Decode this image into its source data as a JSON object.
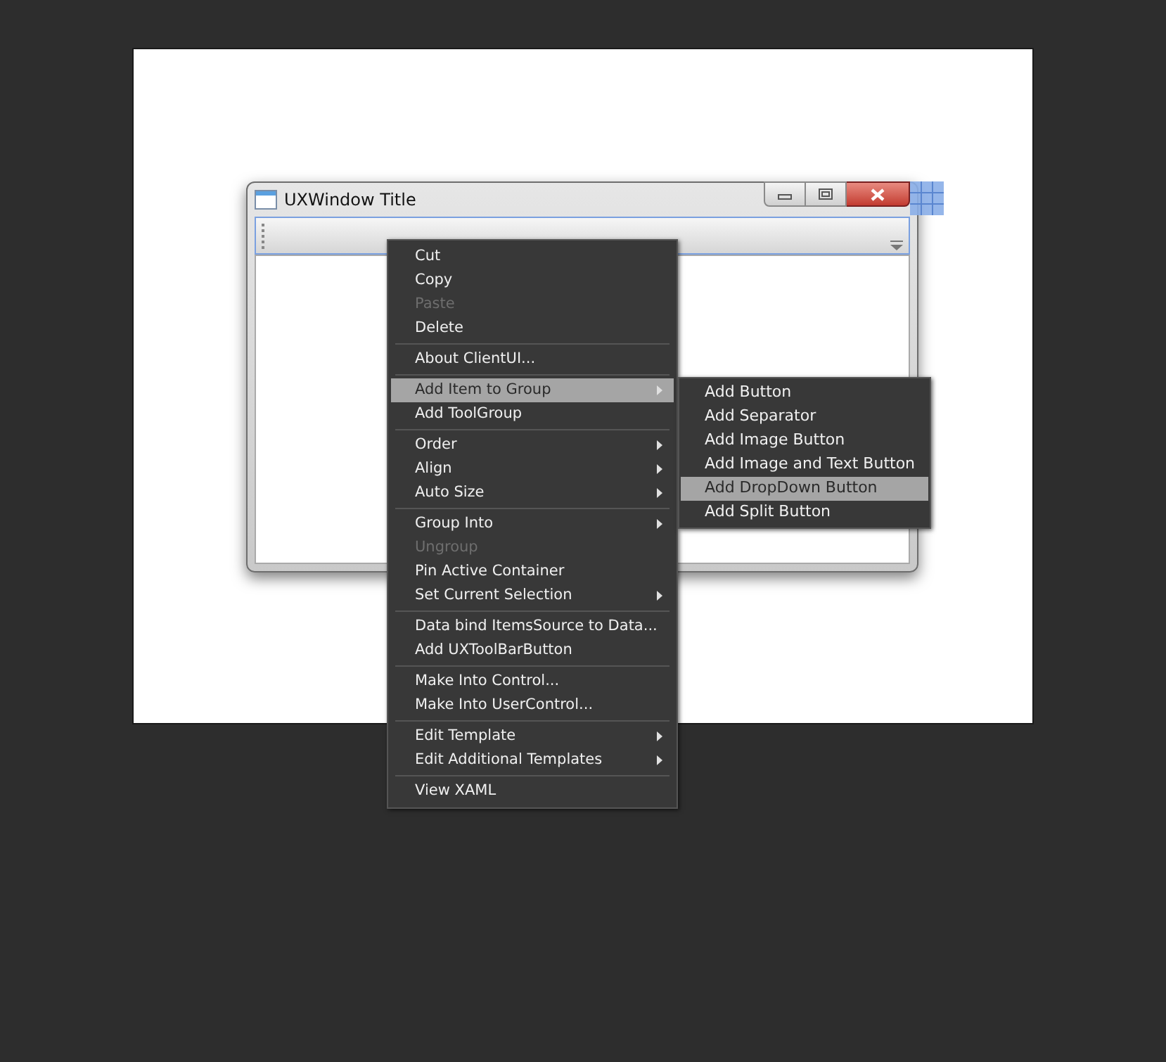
{
  "window": {
    "title": "UXWindow Title"
  },
  "context_menu": {
    "items": [
      {
        "kind": "item",
        "label": "Cut",
        "disabled": false,
        "selected": false,
        "submenu": false
      },
      {
        "kind": "item",
        "label": "Copy",
        "disabled": false,
        "selected": false,
        "submenu": false
      },
      {
        "kind": "item",
        "label": "Paste",
        "disabled": true,
        "selected": false,
        "submenu": false
      },
      {
        "kind": "item",
        "label": "Delete",
        "disabled": false,
        "selected": false,
        "submenu": false
      },
      {
        "kind": "separator"
      },
      {
        "kind": "item",
        "label": "About ClientUI...",
        "disabled": false,
        "selected": false,
        "submenu": false
      },
      {
        "kind": "separator"
      },
      {
        "kind": "item",
        "label": "Add Item to Group",
        "disabled": false,
        "selected": true,
        "submenu": true
      },
      {
        "kind": "item",
        "label": "Add ToolGroup",
        "disabled": false,
        "selected": false,
        "submenu": false
      },
      {
        "kind": "separator"
      },
      {
        "kind": "item",
        "label": "Order",
        "disabled": false,
        "selected": false,
        "submenu": true
      },
      {
        "kind": "item",
        "label": "Align",
        "disabled": false,
        "selected": false,
        "submenu": true
      },
      {
        "kind": "item",
        "label": "Auto Size",
        "disabled": false,
        "selected": false,
        "submenu": true
      },
      {
        "kind": "separator"
      },
      {
        "kind": "item",
        "label": "Group Into",
        "disabled": false,
        "selected": false,
        "submenu": true
      },
      {
        "kind": "item",
        "label": "Ungroup",
        "disabled": true,
        "selected": false,
        "submenu": false
      },
      {
        "kind": "item",
        "label": "Pin Active Container",
        "disabled": false,
        "selected": false,
        "submenu": false
      },
      {
        "kind": "item",
        "label": "Set Current Selection",
        "disabled": false,
        "selected": false,
        "submenu": true
      },
      {
        "kind": "separator"
      },
      {
        "kind": "item",
        "label": "Data bind ItemsSource to Data...",
        "disabled": false,
        "selected": false,
        "submenu": false
      },
      {
        "kind": "item",
        "label": "Add UXToolBarButton",
        "disabled": false,
        "selected": false,
        "submenu": false
      },
      {
        "kind": "separator"
      },
      {
        "kind": "item",
        "label": "Make Into Control...",
        "disabled": false,
        "selected": false,
        "submenu": false
      },
      {
        "kind": "item",
        "label": "Make Into UserControl...",
        "disabled": false,
        "selected": false,
        "submenu": false
      },
      {
        "kind": "separator"
      },
      {
        "kind": "item",
        "label": "Edit Template",
        "disabled": false,
        "selected": false,
        "submenu": true
      },
      {
        "kind": "item",
        "label": "Edit Additional Templates",
        "disabled": false,
        "selected": false,
        "submenu": true
      },
      {
        "kind": "separator"
      },
      {
        "kind": "item",
        "label": "View XAML",
        "disabled": false,
        "selected": false,
        "submenu": false
      }
    ]
  },
  "submenu": {
    "items": [
      {
        "label": "Add Button",
        "selected": false
      },
      {
        "label": "Add Separator",
        "selected": false
      },
      {
        "label": "Add Image Button",
        "selected": false
      },
      {
        "label": "Add Image and Text Button",
        "selected": false
      },
      {
        "label": "Add DropDown Button",
        "selected": true
      },
      {
        "label": "Add Split Button",
        "selected": false
      }
    ]
  }
}
